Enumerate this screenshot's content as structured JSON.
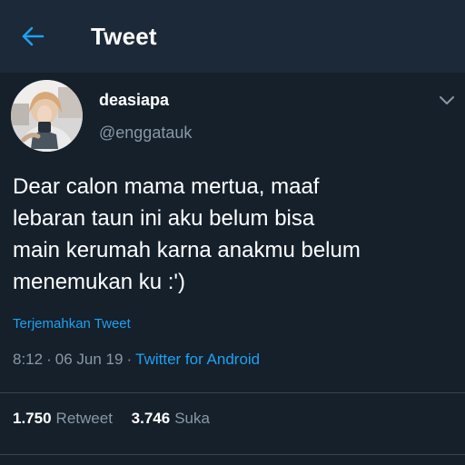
{
  "header": {
    "title": "Tweet",
    "back_icon": "arrow-left-icon"
  },
  "tweet": {
    "display_name": "deasiapa",
    "handle": "@enggatauk",
    "text_lines": [
      "Dear calon mama mertua, maaf",
      "lebaran taun ini aku belum bisa",
      "main kerumah karna anakmu belum",
      "menemukan ku :')"
    ],
    "translate_label": "Terjemahkan Tweet",
    "time": "8:12",
    "date": "06 Jun 19",
    "separator": "·",
    "source": "Twitter for Android",
    "retweets": {
      "count": "1.750",
      "label": "Retweet"
    },
    "likes": {
      "count": "3.746",
      "label": "Suka"
    },
    "more_icon": "chevron-down-icon"
  },
  "colors": {
    "background": "#15202b",
    "header_bg": "#1c2938",
    "accent": "#1da1f2",
    "secondary_text": "#8899a6"
  }
}
